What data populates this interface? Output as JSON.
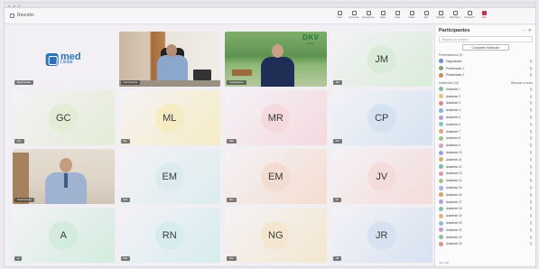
{
  "window": {
    "title": "Reunión"
  },
  "toolbar": {
    "items": [
      {
        "label": "Chat",
        "icon": "chat-icon"
      },
      {
        "label": "Personas",
        "icon": "people-icon"
      },
      {
        "label": "Reacciones",
        "icon": "reaction-icon"
      },
      {
        "label": "Salas",
        "icon": "rooms-icon"
      },
      {
        "label": "Vista",
        "icon": "view-icon"
      },
      {
        "label": "Notas",
        "icon": "notes-icon"
      },
      {
        "label": "Más",
        "icon": "more-icon"
      },
      {
        "label": "Cámara",
        "icon": "camera-icon"
      },
      {
        "label": "Micrófono",
        "icon": "mic-icon"
      },
      {
        "label": "Compartir",
        "icon": "share-icon"
      },
      {
        "label": "Salir",
        "icon": "leave-icon",
        "danger": true
      }
    ]
  },
  "tiles": [
    {
      "kind": "logo",
      "name": "Med Lleida",
      "logo_big": "med",
      "logo_small": "Lleida"
    },
    {
      "kind": "video-office",
      "name": "Participante"
    },
    {
      "kind": "video-park",
      "name": "Participante",
      "brand": "DKV",
      "brand_sub": "Salud"
    },
    {
      "kind": "avatar",
      "initials": "JM",
      "color": "#d9ecd9",
      "name": "JM"
    },
    {
      "kind": "avatar",
      "initials": "GC",
      "color": "#e4ecd5",
      "name": "GC"
    },
    {
      "kind": "avatar",
      "initials": "ML",
      "color": "#f6ecc4",
      "name": "ML"
    },
    {
      "kind": "avatar",
      "initials": "MR",
      "color": "#f4d9df",
      "name": "MR"
    },
    {
      "kind": "avatar",
      "initials": "CP",
      "color": "#d5e3f1",
      "name": "CP"
    },
    {
      "kind": "video-room",
      "name": "Participante"
    },
    {
      "kind": "avatar",
      "initials": "EM",
      "color": "#dcecee",
      "name": "EM"
    },
    {
      "kind": "avatar",
      "initials": "EM",
      "color": "#f5dcd0",
      "name": "EM"
    },
    {
      "kind": "avatar",
      "initials": "JV",
      "color": "#f3dcd9",
      "name": "JV"
    },
    {
      "kind": "avatar",
      "initials": "A",
      "color": "#d3ecdf",
      "name": "A"
    },
    {
      "kind": "avatar",
      "initials": "RN",
      "color": "#d7ecee",
      "name": "RN"
    },
    {
      "kind": "avatar",
      "initials": "NG",
      "color": "#f3e7cf",
      "name": "NG"
    },
    {
      "kind": "avatar",
      "initials": "JR",
      "color": "#d6e2f1",
      "name": "JR"
    }
  ],
  "panel": {
    "title": "Participantes",
    "search_placeholder": "Buscar un nombre",
    "share_label": "Compartir invitación",
    "presenters_label": "Presentadores (3)",
    "attendees_label": "Asistentes (16)",
    "mute_all": "Silenciar a todos",
    "presenters": [
      {
        "name": "Organizador",
        "color": "#6b8fc7"
      },
      {
        "name": "Presentador 1",
        "color": "#7fa76f"
      },
      {
        "name": "Presentador 2",
        "color": "#c58f5d"
      }
    ],
    "attendees": [
      {
        "name": "Asistente 1",
        "color": "#7bbf8a"
      },
      {
        "name": "Asistente 2",
        "color": "#e3c66a"
      },
      {
        "name": "Asistente 3",
        "color": "#d98b8b"
      },
      {
        "name": "Asistente 4",
        "color": "#8cb0de"
      },
      {
        "name": "Asistente 5",
        "color": "#b69ad3"
      },
      {
        "name": "Asistente 6",
        "color": "#7fc4c4"
      },
      {
        "name": "Asistente 7",
        "color": "#e0a37a"
      },
      {
        "name": "Asistente 8",
        "color": "#9ac47f"
      },
      {
        "name": "Asistente 9",
        "color": "#d6a0c2"
      },
      {
        "name": "Asistente 10",
        "color": "#8fa7d6"
      },
      {
        "name": "Asistente 11",
        "color": "#c9b56f"
      },
      {
        "name": "Asistente 12",
        "color": "#7fb9a4"
      },
      {
        "name": "Asistente 13",
        "color": "#e29a9a"
      },
      {
        "name": "Asistente 14",
        "color": "#a3c57d"
      },
      {
        "name": "Asistente 15",
        "color": "#9fb6e0"
      },
      {
        "name": "Asistente 16",
        "color": "#d4a66f"
      },
      {
        "name": "Asistente 17",
        "color": "#b49fd8"
      },
      {
        "name": "Asistente 18",
        "color": "#7dc1b0"
      },
      {
        "name": "Asistente 19",
        "color": "#e0b37d"
      },
      {
        "name": "Asistente 20",
        "color": "#92b8d8"
      },
      {
        "name": "Asistente 21",
        "color": "#c79bc9"
      },
      {
        "name": "Asistente 22",
        "color": "#8fc38f"
      },
      {
        "name": "Asistente 23",
        "color": "#d9907f"
      }
    ],
    "footer": "Ver todo"
  }
}
